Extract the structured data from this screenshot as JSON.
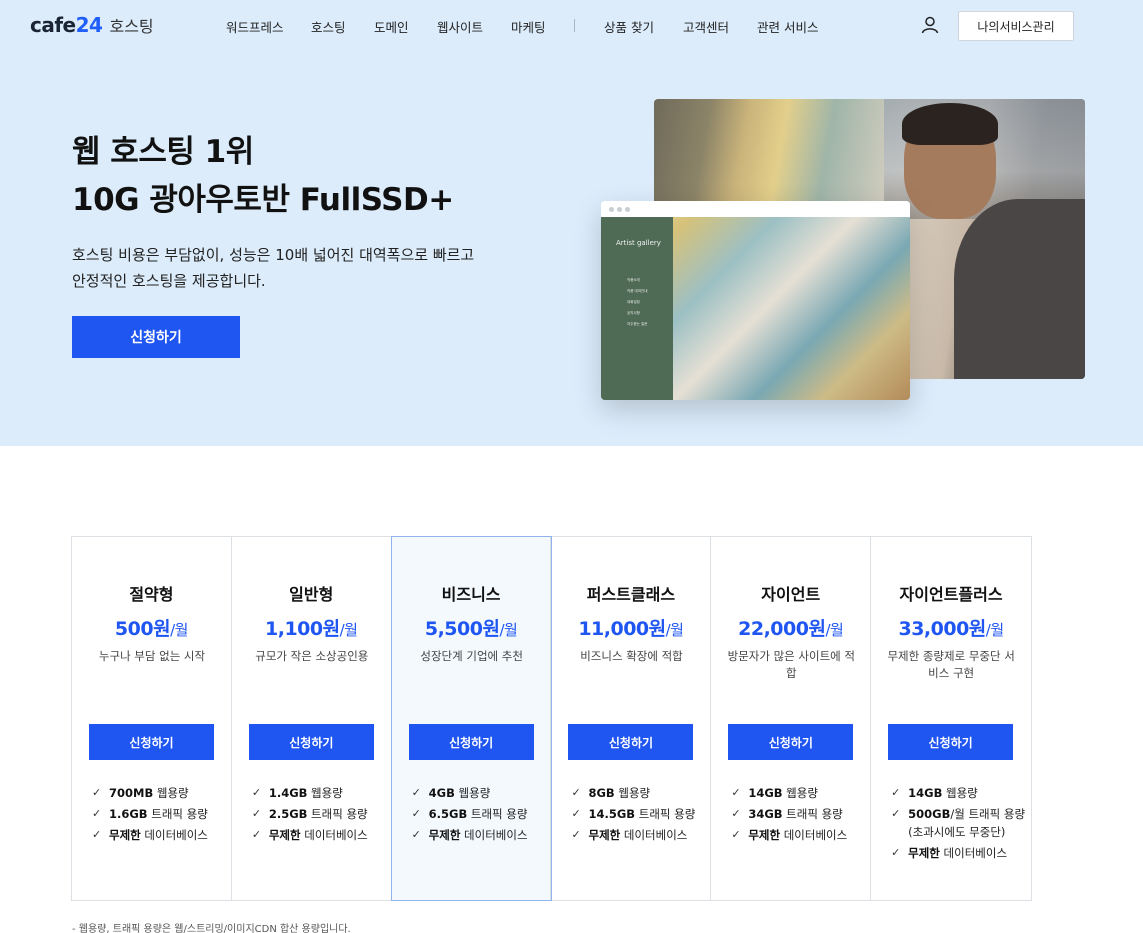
{
  "header": {
    "logo_text": "cafe",
    "logo_num": "24",
    "logo_sub": "호스팅",
    "nav": [
      "워드프레스",
      "호스팅",
      "도메인",
      "웹사이트",
      "마케팅",
      "상품 찾기",
      "고객센터",
      "관련 서비스"
    ],
    "my_service_button": "나의서비스관리"
  },
  "hero": {
    "title_line1": "웹 호스팅 1위",
    "title_line2": "10G 광아우토반 FullSSD+",
    "desc_line1": "호스팅 비용은 부담없이, 성능은 10배 넓어진 대역폭으로 빠르고",
    "desc_line2": "안정적인 호스팅을 제공합니다.",
    "apply_button": "신청하기",
    "gallery_title": "Artist gallery",
    "gallery_menu": [
      "작품소개",
      "작품 대여안내",
      "대회일정",
      "공지사항",
      "자주묻는 질문"
    ]
  },
  "plans": [
    {
      "name": "절약형",
      "price": "500원",
      "unit": "/월",
      "desc": "누구나 부담 없는 시작",
      "button": "신청하기",
      "features": [
        {
          "bold": "700MB",
          "text": " 웹용량"
        },
        {
          "bold": "1.6GB",
          "text": " 트래픽 용량"
        },
        {
          "bold": "무제한",
          "text": " 데이터베이스"
        }
      ]
    },
    {
      "name": "일반형",
      "price": "1,100원",
      "unit": "/월",
      "desc": "규모가 작은 소상공인용",
      "button": "신청하기",
      "features": [
        {
          "bold": "1.4GB",
          "text": " 웹용량"
        },
        {
          "bold": "2.5GB",
          "text": " 트래픽 용량"
        },
        {
          "bold": "무제한",
          "text": " 데이터베이스"
        }
      ]
    },
    {
      "name": "비즈니스",
      "price": "5,500원",
      "unit": "/월",
      "desc": "성장단계 기업에 추천",
      "button": "신청하기",
      "features": [
        {
          "bold": "4GB",
          "text": " 웹용량"
        },
        {
          "bold": "6.5GB",
          "text": " 트래픽 용량"
        },
        {
          "bold": "무제한",
          "text": " 데이터베이스"
        }
      ]
    },
    {
      "name": "퍼스트클래스",
      "price": "11,000원",
      "unit": "/월",
      "desc": "비즈니스 확장에 적합",
      "button": "신청하기",
      "features": [
        {
          "bold": "8GB",
          "text": " 웹용량"
        },
        {
          "bold": "14.5GB",
          "text": " 트래픽 용량"
        },
        {
          "bold": "무제한",
          "text": " 데이터베이스"
        }
      ]
    },
    {
      "name": "자이언트",
      "price": "22,000원",
      "unit": "/월",
      "desc": "방문자가 많은 사이트에 적합",
      "button": "신청하기",
      "features": [
        {
          "bold": "14GB",
          "text": " 웹용량"
        },
        {
          "bold": "34GB",
          "text": " 트래픽 용량"
        },
        {
          "bold": "무제한",
          "text": " 데이터베이스"
        }
      ]
    },
    {
      "name": "자이언트플러스",
      "price": "33,000원",
      "unit": "/월",
      "desc": "무제한 종량제로 무중단 서비스 구현",
      "button": "신청하기",
      "features": [
        {
          "bold": "14GB",
          "text": " 웹용량"
        },
        {
          "bold": "500GB",
          "text": "/월 트래픽 용량 (초과시에도 무중단)"
        },
        {
          "bold": "무제한",
          "text": " 데이터베이스"
        }
      ]
    }
  ],
  "footnote": "- 웹용량, 트래픽 용량은 웹/스트리밍/이미지CDN 합산 용량입니다.",
  "colors": {
    "accent": "#1f56f2",
    "hero_bg": "#dcecfb"
  }
}
